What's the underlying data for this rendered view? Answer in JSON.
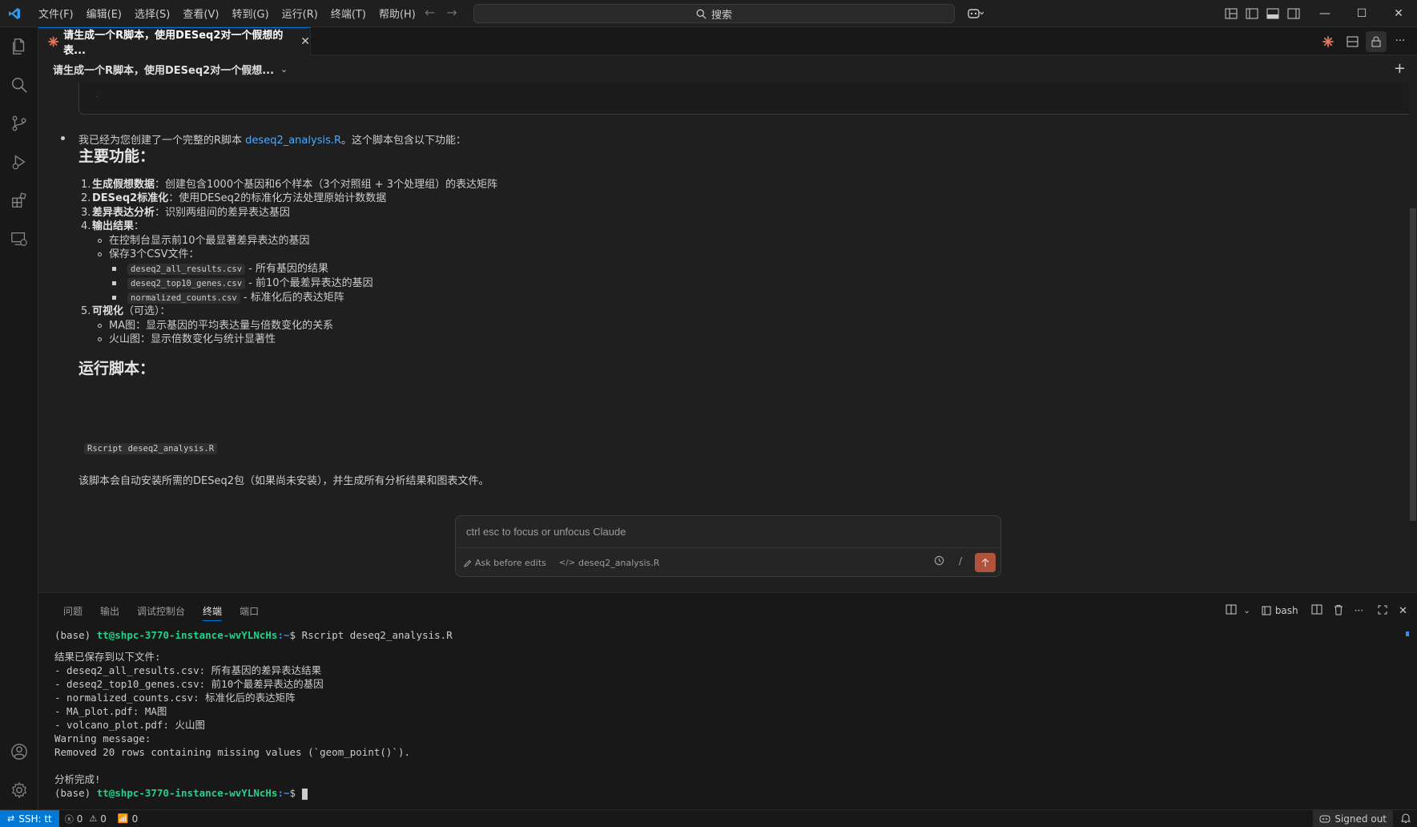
{
  "titlebar": {
    "menu": [
      "文件(F)",
      "编辑(E)",
      "选择(S)",
      "查看(V)",
      "转到(G)",
      "运行(R)",
      "终端(T)",
      "帮助(H)"
    ],
    "search_label": "搜索"
  },
  "editor": {
    "tab_title": "请生成一个R脚本，使用DESeq2对一个假想的表...",
    "session_title": "请生成一个R脚本，使用DESeq2对一个假想..."
  },
  "chat": {
    "intro_prefix": "我已经为您创建了一个完整的R脚本 ",
    "intro_link": "deseq2_analysis.R",
    "intro_suffix": "。这个脚本包含以下功能：",
    "h_main": "主要功能：",
    "items": [
      {
        "num": "1.",
        "bold": "生成假想数据",
        "rest": "：创建包含1000个基因和6个样本（3个对照组 + 3个处理组）的表达矩阵"
      },
      {
        "num": "2.",
        "bold": "DESeq2标准化",
        "rest": "：使用DESeq2的标准化方法处理原始计数数据"
      },
      {
        "num": "3.",
        "bold": "差异表达分析",
        "rest": "：识别两组间的差异表达基因"
      },
      {
        "num": "4.",
        "bold": "输出结果",
        "rest": "："
      },
      {
        "num": "5.",
        "bold": "可视化",
        "rest": "（可选）："
      }
    ],
    "output_sub": [
      "在控制台显示前10个最显著差异表达的基因",
      "保存3个CSV文件："
    ],
    "csv_files": [
      {
        "code": "deseq2_all_results.csv",
        "desc": " - 所有基因的结果"
      },
      {
        "code": "deseq2_top10_genes.csv",
        "desc": " - 前10个最差异表达的基因"
      },
      {
        "code": "normalized_counts.csv",
        "desc": " - 标准化后的表达矩阵"
      }
    ],
    "vis_sub": [
      "MA图：显示基因的平均表达量与倍数变化的关系",
      "火山图：显示倍数变化与统计显著性"
    ],
    "h_run": "运行脚本：",
    "run_cmd": "Rscript deseq2_analysis.R",
    "closing": "该脚本会自动安装所需的DESeq2包（如果尚未安装），并生成所有分析结果和图表文件。"
  },
  "input": {
    "placeholder": "ctrl esc to focus or unfocus Claude",
    "mode_label": "Ask before edits",
    "file_label": "deseq2_analysis.R",
    "slash": "/"
  },
  "panel": {
    "tabs": [
      "问题",
      "输出",
      "调试控制台",
      "终端",
      "端口"
    ],
    "active_tab": "终端",
    "shell": "bash",
    "terminal": {
      "prompt_prefix": "(base) ",
      "prompt_user_host": "tt@shpc-3770-instance-wvYLNcHs",
      "prompt_path": ":~",
      "prompt_symbol": "$ ",
      "command": "Rscript deseq2_analysis.R",
      "output": [
        "结果已保存到以下文件:",
        "- deseq2_all_results.csv: 所有基因的差异表达结果",
        "- deseq2_top10_genes.csv: 前10个最差异表达的基因",
        "- normalized_counts.csv: 标准化后的表达矩阵",
        "- MA_plot.pdf: MA图",
        "- volcano_plot.pdf: 火山图",
        "Warning message:",
        "Removed 20 rows containing missing values (`geom_point()`).",
        "",
        "分析完成!"
      ]
    }
  },
  "statusbar": {
    "remote": "SSH: tt",
    "errors": "0",
    "warnings": "0",
    "ports": "0",
    "signed_out": "Signed out"
  },
  "colors": {
    "accent": "#0078d4",
    "link": "#4daafc",
    "send_button": "#b0533c",
    "terminal_user": "#23d18b",
    "terminal_path": "#3b8eea"
  }
}
